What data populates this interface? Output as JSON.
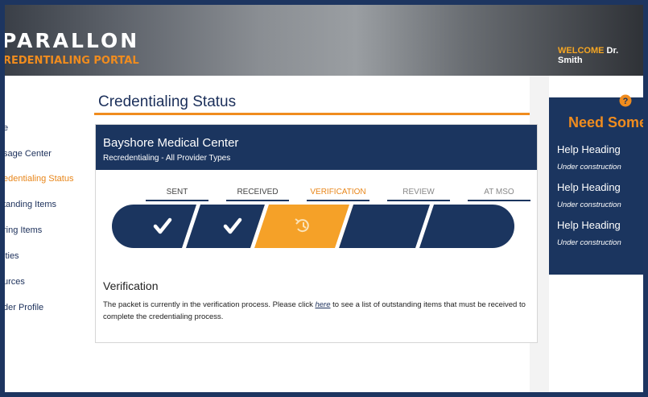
{
  "header": {
    "logo_text": "PARALLON",
    "portal_name": "REDENTIALING PORTAL",
    "welcome_keyword": "WELCOME",
    "user_name": "Dr. Smith"
  },
  "sidebar": {
    "items": [
      {
        "label": "e"
      },
      {
        "label": "sage Center"
      },
      {
        "label": "edentialing Status",
        "active": true
      },
      {
        "label": "tanding Items"
      },
      {
        "label": "ring Items"
      },
      {
        "label": "ities"
      },
      {
        "label": "urces"
      },
      {
        "label": "der Profile"
      }
    ]
  },
  "main": {
    "page_title": "Credentialing Status",
    "card": {
      "facility": "Bayshore Medical Center",
      "program": "Recredentialing - All Provider Types",
      "steps": [
        {
          "label": "SENT",
          "state": "complete",
          "icon": "checkmark-icon"
        },
        {
          "label": "RECEIVED",
          "state": "complete",
          "icon": "checkmark-icon"
        },
        {
          "label": "VERIFICATION",
          "state": "current",
          "icon": "history-icon"
        },
        {
          "label": "REVIEW",
          "state": "pending"
        },
        {
          "label": "AT MSO",
          "state": "pending"
        }
      ],
      "detail_heading": "Verification",
      "detail_text_before": "The packet is currently in the verification process. Please click ",
      "detail_link": "here",
      "detail_text_after": " to see a list of outstanding items that must be received to complete the credentialing process."
    }
  },
  "help_panel": {
    "icon": "question-icon",
    "heading": "Need Some",
    "items": [
      {
        "heading": "Help Heading",
        "sub": "Under construction"
      },
      {
        "heading": "Help Heading",
        "sub": "Under construction"
      },
      {
        "heading": "Help Heading",
        "sub": "Under construction"
      }
    ]
  },
  "colors": {
    "navy": "#1b355f",
    "orange": "#f08c1e",
    "step_current": "#f5a128",
    "text_muted": "#888888"
  }
}
